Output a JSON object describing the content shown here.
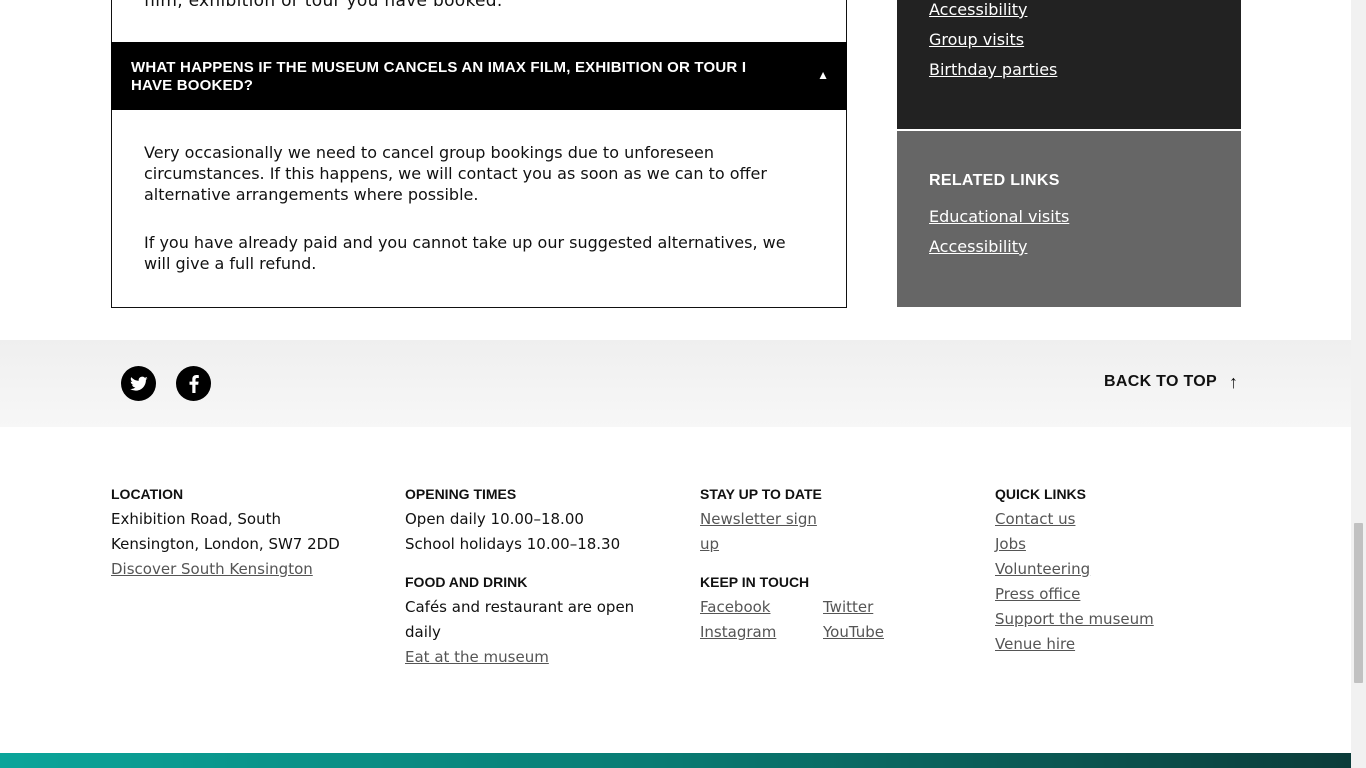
{
  "accordion": {
    "previous_text_tail": "film, exhibition or tour you have booked.",
    "title": "WHAT HAPPENS IF THE MUSEUM CANCELS AN IMAX FILM, EXHIBITION OR TOUR I HAVE BOOKED?",
    "toggle_glyph": "▲",
    "paragraphs": [
      "Very occasionally we need to cancel group bookings due to unforeseen circumstances. If this happens, we will contact you as soon as we can to offer alternative arrangements where possible.",
      "If you have already paid and you cannot take up our suggested alternatives, we will give a full refund."
    ]
  },
  "sidebar": {
    "dark_links": [
      "Accessibility",
      "Group visits",
      "Birthday parties"
    ],
    "related": {
      "heading": "RELATED LINKS",
      "links": [
        "Educational visits",
        "Accessibility"
      ]
    }
  },
  "share": {
    "twitter_icon": "twitter-icon",
    "facebook_icon": "facebook-icon",
    "back_to_top": "BACK TO TOP",
    "back_arrow": "↑"
  },
  "footer": {
    "location": {
      "heading": "LOCATION",
      "line1": "Exhibition Road, South",
      "line2": "Kensington, London, SW7 2DD",
      "link": "Discover South Kensington"
    },
    "opening": {
      "heading": "OPENING TIMES",
      "line1": "Open daily 10.00–18.00",
      "line2": "School holidays 10.00–18.30"
    },
    "food": {
      "heading": "FOOD AND DRINK",
      "line1": "Cafés and restaurant are open",
      "line2": "daily",
      "link": "Eat at the museum"
    },
    "stay": {
      "heading": "STAY UP TO DATE",
      "link_line1": "Newsletter sign",
      "link_line2": "up"
    },
    "keep": {
      "heading": "KEEP IN TOUCH",
      "links": [
        "Facebook",
        "Twitter",
        "Instagram",
        "YouTube"
      ]
    },
    "quick": {
      "heading": "QUICK LINKS",
      "links": [
        "Contact us",
        "Jobs",
        "Volunteering",
        "Press office",
        "Support the museum",
        "Venue hire"
      ]
    }
  },
  "colors": {
    "sidebar_dark": "#222222",
    "sidebar_grey": "#666666",
    "band_start": "#0aa59a",
    "band_end": "#0b3c3a"
  }
}
